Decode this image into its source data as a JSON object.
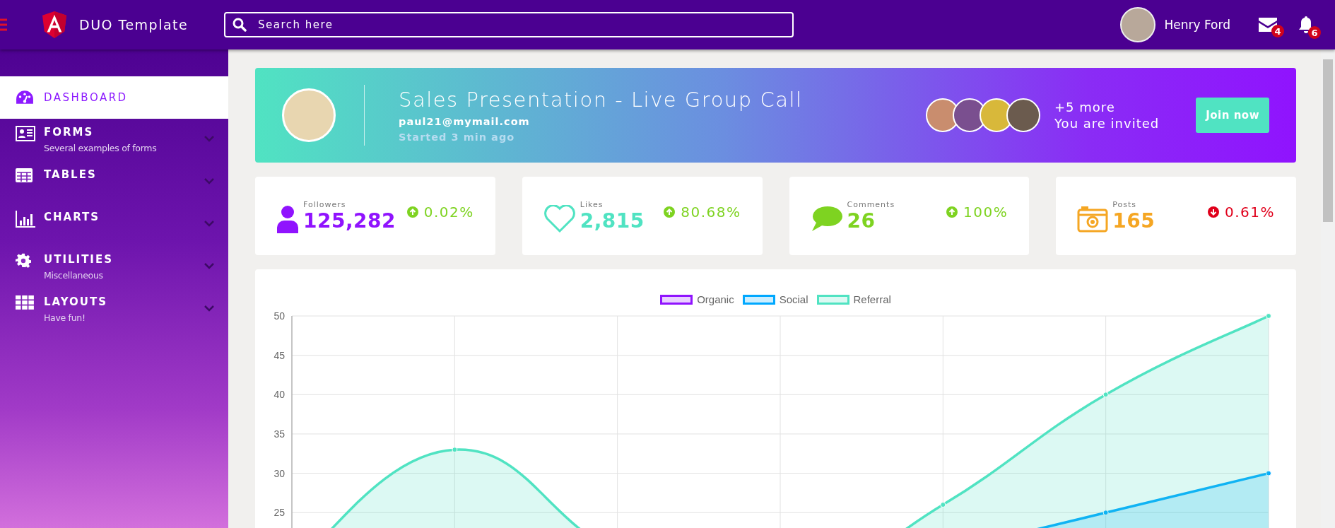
{
  "topbar": {
    "brand": "DUO Template",
    "search": {
      "placeholder": "Search here"
    },
    "user": {
      "name": "Henry Ford"
    },
    "notifications": [
      {
        "kind": "mail",
        "count": "4"
      },
      {
        "kind": "bell",
        "count": "6"
      }
    ]
  },
  "sidebar": {
    "items": [
      {
        "kind": "dashboard",
        "label": "DASHBOARD",
        "selected": true
      },
      {
        "kind": "forms",
        "label": "FORMS",
        "subtitle": "Several examples of forms",
        "selected": false
      },
      {
        "kind": "tables",
        "label": "TABLES",
        "selected": false
      },
      {
        "kind": "charts",
        "label": "CHARTS",
        "selected": false
      },
      {
        "kind": "utilities",
        "label": "UTILITIES",
        "subtitle": "Miscellaneous",
        "selected": false
      },
      {
        "kind": "layouts",
        "label": "LAYOUTS",
        "subtitle": "Have fun!",
        "selected": false
      }
    ]
  },
  "banner": {
    "title": "Sales Presentation - Live Group Call",
    "email": "paul21@mymail.com",
    "status": "Started 3 min ago",
    "invite_count": "+5 more",
    "invite_text": "You are invited",
    "button": "Join now"
  },
  "stats": [
    {
      "kind": "person",
      "label": "Followers",
      "value": "125,282",
      "change": "0.02%",
      "increase": true,
      "color": "#9013fe"
    },
    {
      "kind": "heart",
      "label": "Likes",
      "value": "2,815",
      "change": "80.68%",
      "increase": true,
      "color": "#50e3c2"
    },
    {
      "kind": "comment",
      "label": "Comments",
      "value": "26",
      "change": "100%",
      "increase": true,
      "color": "#7ed321"
    },
    {
      "kind": "camera",
      "label": "Posts",
      "value": "165",
      "change": "0.61%",
      "increase": false,
      "color": "#f5a623"
    }
  ],
  "chart": {
    "chart_data": {
      "type": "area",
      "grid": true,
      "legend": "top",
      "ylim": [
        0,
        50
      ],
      "yticks": [
        25,
        30,
        35,
        40,
        45,
        50
      ],
      "series": [
        {
          "name": "Organic",
          "color": "#9013fe",
          "values": [
            null,
            null,
            null,
            null,
            null,
            null,
            null
          ]
        },
        {
          "name": "Social",
          "color": "#00a8ff",
          "values": [
            null,
            null,
            null,
            null,
            20,
            25,
            30
          ]
        },
        {
          "name": "Referral",
          "color": "#50e3c2",
          "values": [
            18,
            33,
            20,
            15,
            26,
            40,
            50
          ]
        }
      ]
    }
  }
}
